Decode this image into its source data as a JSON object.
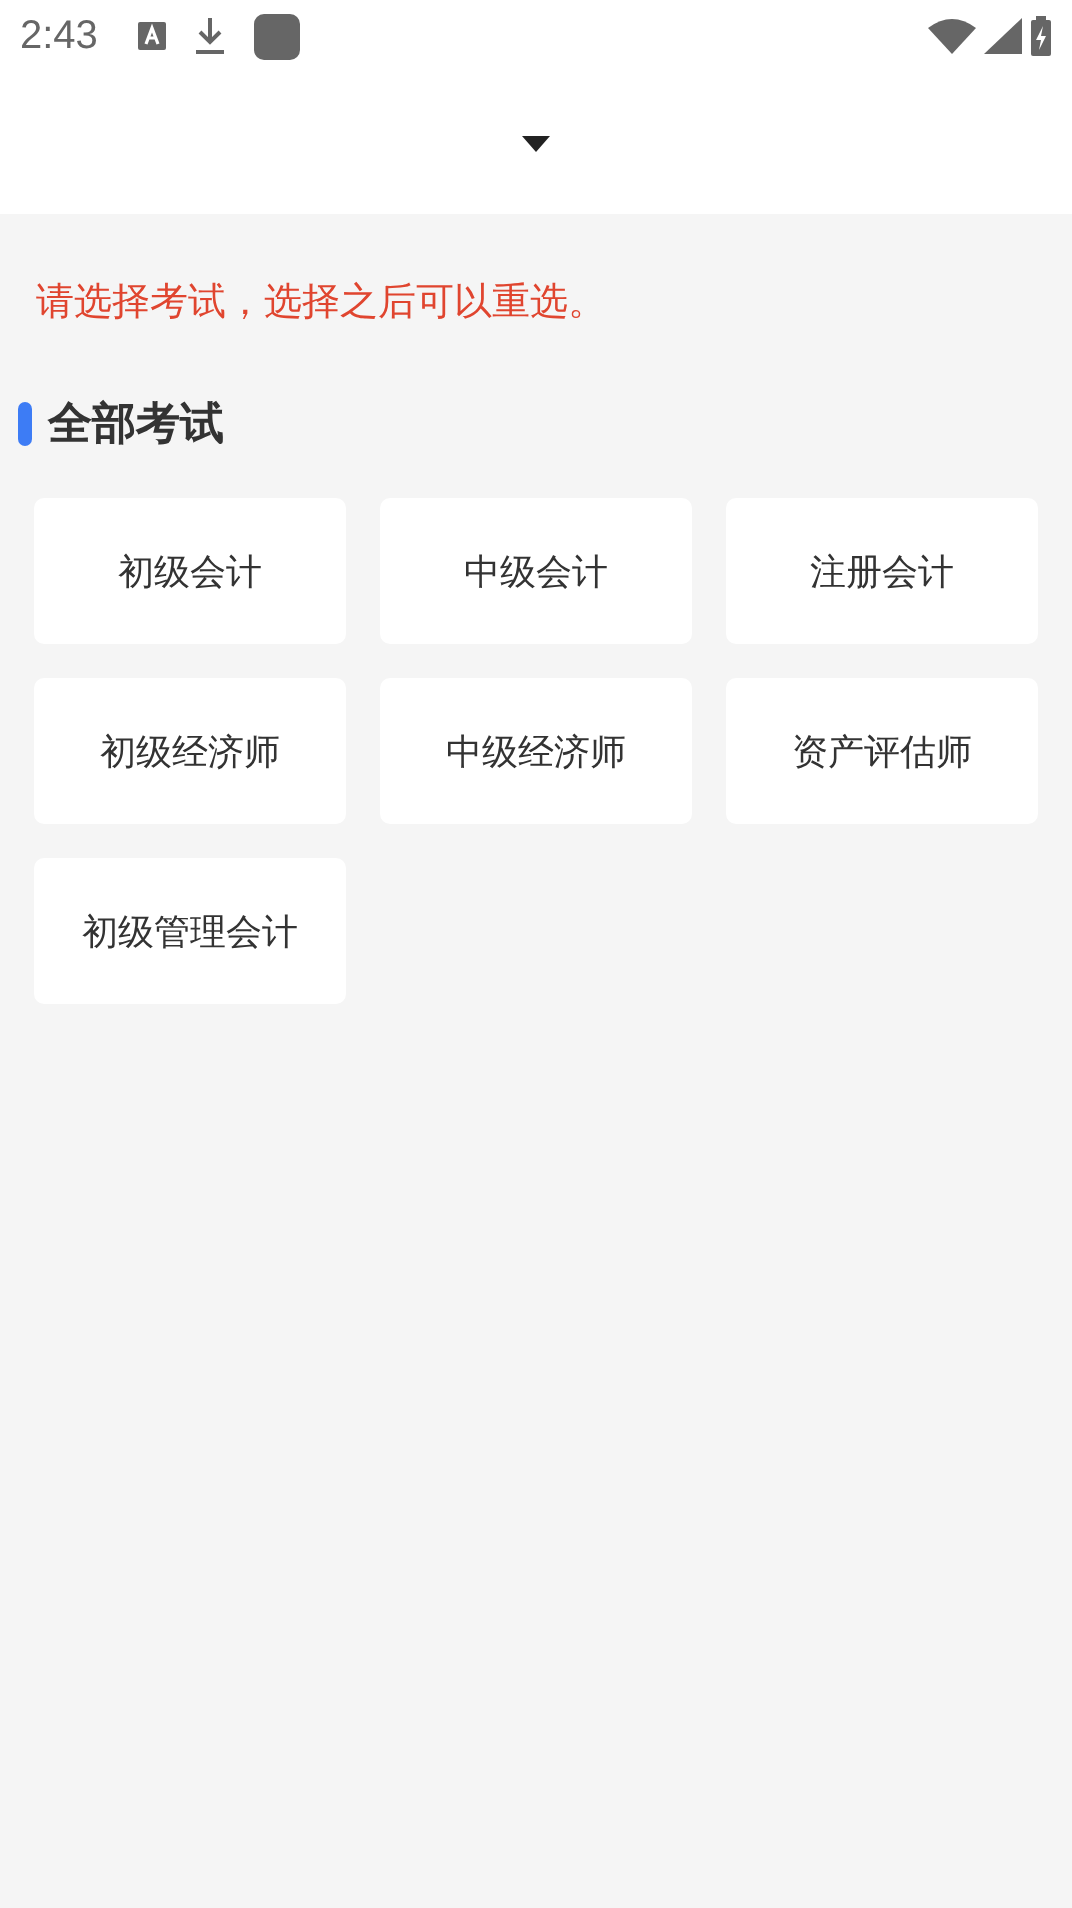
{
  "status_bar": {
    "time": "2:43"
  },
  "tip": "请选择考试，选择之后可以重选。",
  "section": {
    "title": "全部考试",
    "exams": [
      {
        "label": "初级会计"
      },
      {
        "label": "中级会计"
      },
      {
        "label": "注册会计"
      },
      {
        "label": "初级经济师"
      },
      {
        "label": "中级经济师"
      },
      {
        "label": "资产评估师"
      },
      {
        "label": "初级管理会计"
      }
    ]
  }
}
